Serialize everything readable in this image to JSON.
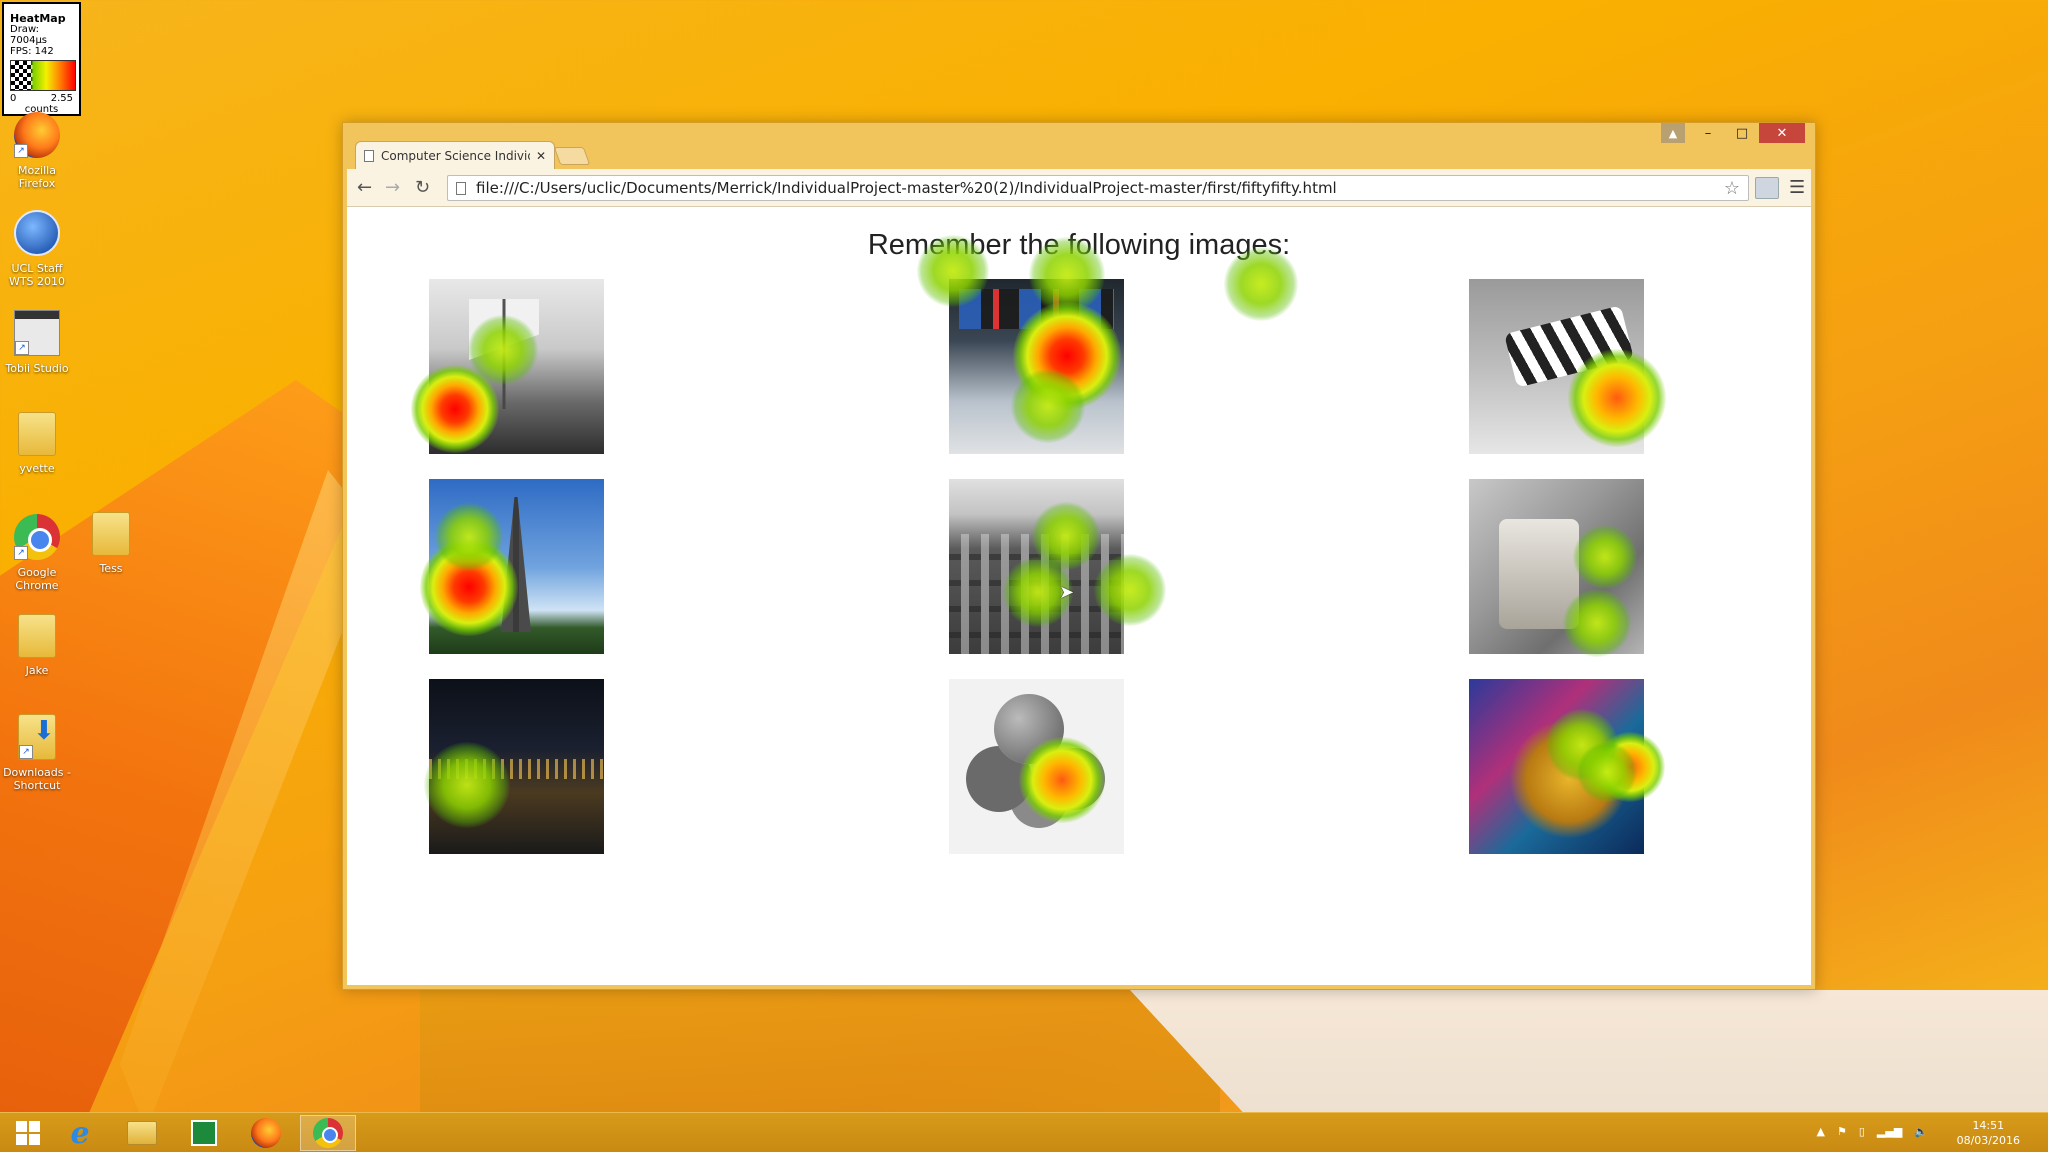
{
  "heatmap_widget": {
    "title": "HeatMap",
    "draw": "Draw: 7004µs",
    "fps": "FPS: 142",
    "scale_min": "0",
    "scale_max": "2.55",
    "unit": "counts"
  },
  "desktop_icons": [
    {
      "name": "firefox",
      "label": "Mozilla Firefox",
      "icon": "firefox-icon"
    },
    {
      "name": "ucl",
      "label": "UCL Staff WTS 2010",
      "icon": "remote-desktop-icon"
    },
    {
      "name": "tobii",
      "label": "Tobii Studio",
      "icon": "clapperboard-icon"
    },
    {
      "name": "yvette",
      "label": "yvette",
      "icon": "folder-icon"
    },
    {
      "name": "chrome",
      "label": "Google Chrome",
      "icon": "chrome-icon"
    },
    {
      "name": "tess",
      "label": "Tess",
      "icon": "folder-icon"
    },
    {
      "name": "jake",
      "label": "Jake",
      "icon": "folder-icon"
    },
    {
      "name": "downloads",
      "label": "Downloads - Shortcut",
      "icon": "downloads-folder-icon"
    }
  ],
  "browser": {
    "tab_title": "Computer Science Individ",
    "url": "file:///C:/Users/uclic/Documents/Merrick/IndividualProject-master%20(2)/IndividualProject-master/first/fiftyfifty.html",
    "controls": {
      "minimize": "–",
      "maximize": "□",
      "close": "✕"
    }
  },
  "page": {
    "heading": "Remember the following images:",
    "images": [
      "tall ship",
      "marathon runners",
      "windsock",
      "eiffel tower",
      "building",
      "toaster",
      "city at night",
      "fruit",
      "dragon"
    ]
  },
  "heat_points": [
    {
      "level": "high"
    },
    {
      "level": "low"
    },
    {
      "level": "high"
    },
    {
      "level": "low"
    },
    {
      "level": "low"
    },
    {
      "level": "low"
    },
    {
      "level": "low"
    },
    {
      "level": "high"
    },
    {
      "level": "low"
    },
    {
      "level": "mid"
    },
    {
      "level": "low"
    },
    {
      "level": "low"
    },
    {
      "level": "low"
    },
    {
      "level": "low"
    },
    {
      "level": "low"
    },
    {
      "level": "low"
    },
    {
      "level": "mid"
    },
    {
      "level": "mid"
    },
    {
      "level": "low"
    },
    {
      "level": "low"
    }
  ],
  "taskbar": {
    "items": [
      "start",
      "internet-explorer",
      "file-explorer",
      "store",
      "firefox",
      "chrome"
    ],
    "active": "chrome",
    "time": "14:51",
    "date": "08/03/2016"
  }
}
